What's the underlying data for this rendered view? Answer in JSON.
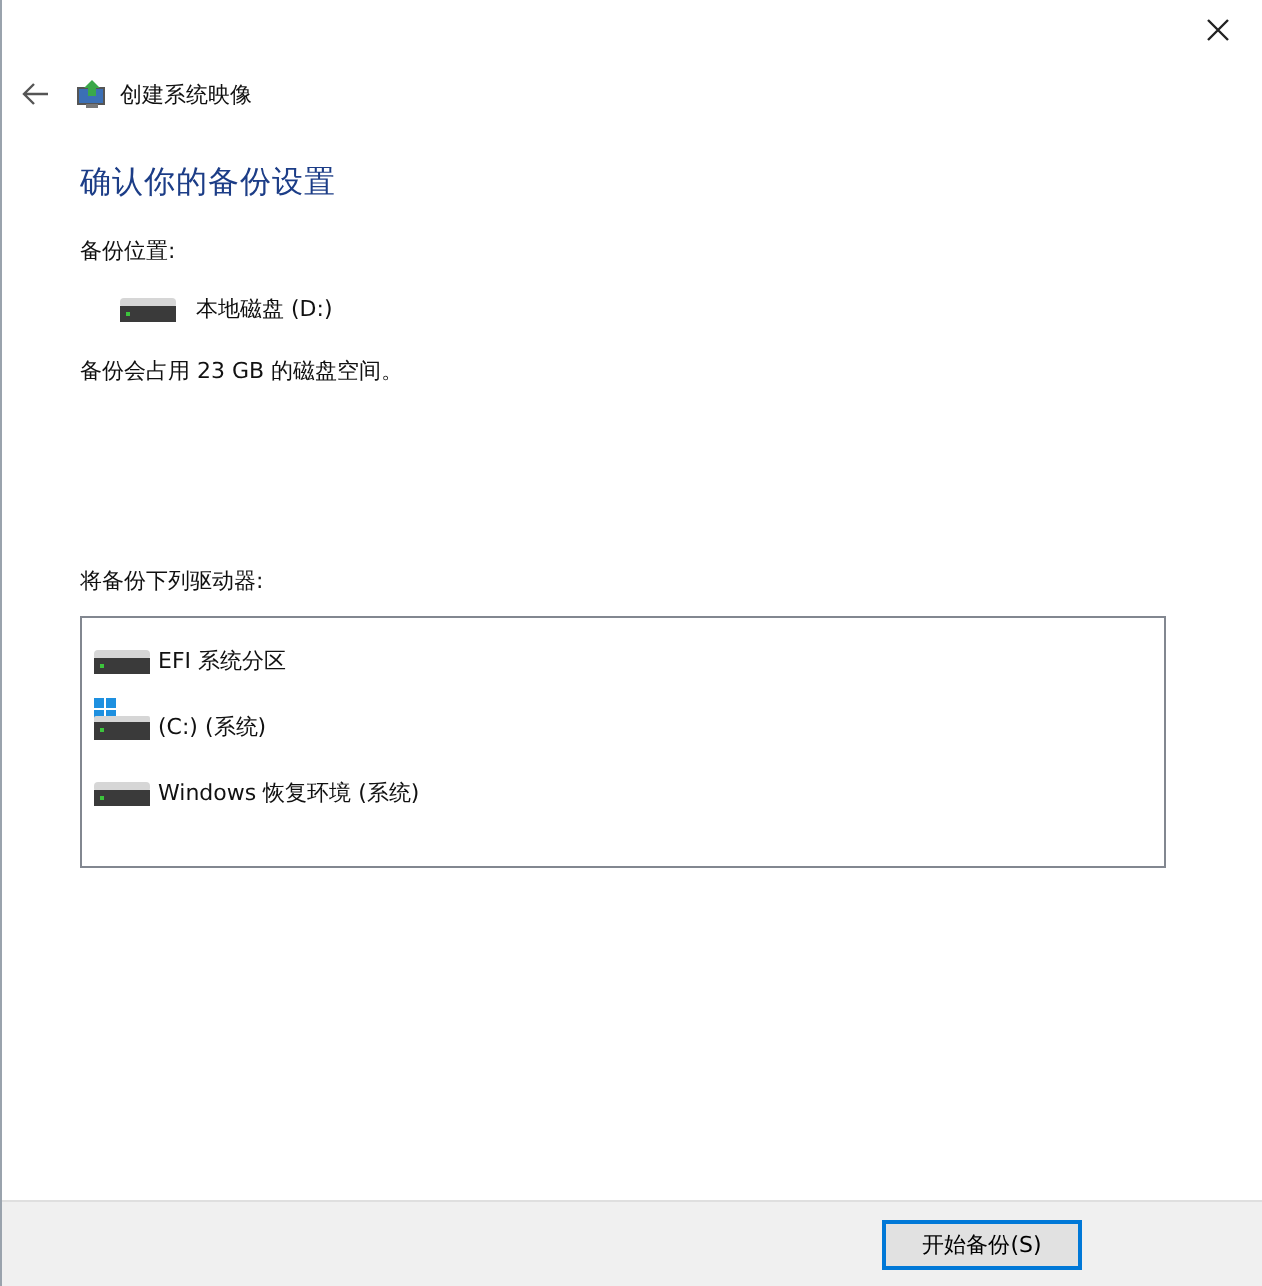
{
  "window": {
    "title": "创建系统映像"
  },
  "heading": "确认你的备份设置",
  "location": {
    "label": "备份位置:",
    "drive": "本地磁盘 (D:)"
  },
  "usage": "备份会占用 23 GB 的磁盘空间。",
  "drives": {
    "label": "将备份下列驱动器:",
    "items": [
      {
        "name": "EFI 系统分区",
        "kind": "disk"
      },
      {
        "name": "(C:) (系统)",
        "kind": "system"
      },
      {
        "name": "Windows 恢复环境 (系统)",
        "kind": "disk"
      }
    ]
  },
  "buttons": [
    {
      "label": "开始备份(S)",
      "default": true
    }
  ]
}
